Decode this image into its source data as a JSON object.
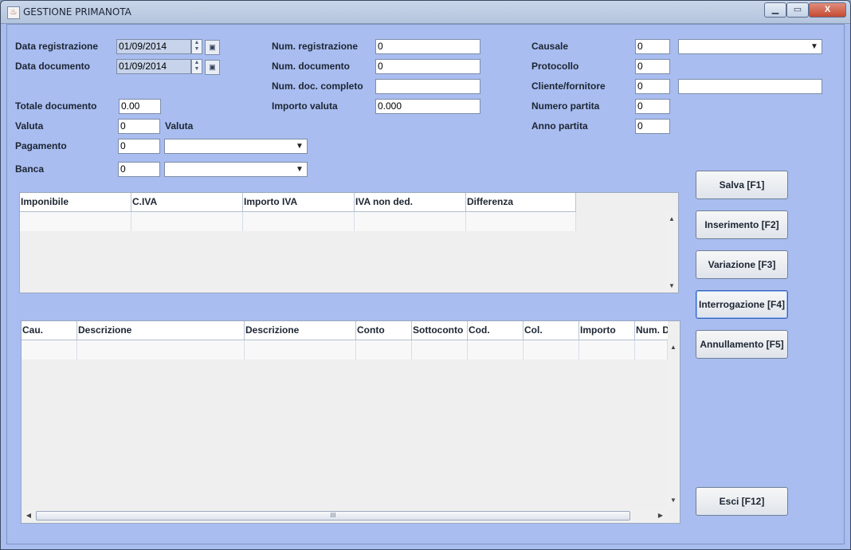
{
  "window": {
    "title": "GESTIONE PRIMANOTA",
    "minimize": "▁",
    "maximize": "▭",
    "close": "X",
    "app_icon": "java-cup-icon"
  },
  "form": {
    "data_registrazione": {
      "label": "Data registrazione",
      "value": "01/09/2014"
    },
    "data_documento": {
      "label": "Data documento",
      "value": "01/09/2014"
    },
    "totale_documento": {
      "label": "Totale documento",
      "value": "0.00"
    },
    "valuta": {
      "label": "Valuta",
      "value": "0",
      "desc": "Valuta"
    },
    "pagamento": {
      "label": "Pagamento",
      "value": "0",
      "select": ""
    },
    "banca": {
      "label": "Banca",
      "value": "0",
      "select": ""
    },
    "num_registrazione": {
      "label": "Num. registrazione",
      "value": "0"
    },
    "num_documento": {
      "label": "Num. documento",
      "value": "0"
    },
    "num_doc_completo": {
      "label": "Num. doc. completo",
      "value": ""
    },
    "importo_valuta": {
      "label": "Importo valuta",
      "value": "0.000"
    },
    "causale": {
      "label": "Causale",
      "value": "0",
      "select": ""
    },
    "protocollo": {
      "label": "Protocollo",
      "value": "0"
    },
    "cliente_fornitore": {
      "label": "Cliente/fornitore",
      "value": "0",
      "desc": ""
    },
    "numero_partita": {
      "label": "Numero partita",
      "value": "0"
    },
    "anno_partita": {
      "label": "Anno partita",
      "value": "0"
    }
  },
  "iva_table": {
    "columns": [
      "Imponibile",
      "C.IVA",
      "Importo IVA",
      "IVA non ded.",
      "Differenza"
    ]
  },
  "detail_table": {
    "columns": [
      "Cau.",
      "Descrizione",
      "Descrizione",
      "Conto",
      "Sottoconto",
      "Cod.",
      "Col.",
      "Importo",
      "Num. D"
    ]
  },
  "buttons": {
    "salva": "Salva  [F1]",
    "inserimento": "Inserimento [F2]",
    "variazione": "Variazione [F3]",
    "interrogazione": "Interrogazione [F4]",
    "annullamento": "Annullamento [F5]",
    "esci": "Esci [F12]"
  },
  "glyphs": {
    "spin_up": "▲",
    "spin_down": "▼",
    "calendar": "▣",
    "dropdown": "▼",
    "scroll_up": "▲",
    "scroll_down": "▼",
    "scroll_left": "◀",
    "scroll_right": "▶",
    "grip": "III"
  }
}
